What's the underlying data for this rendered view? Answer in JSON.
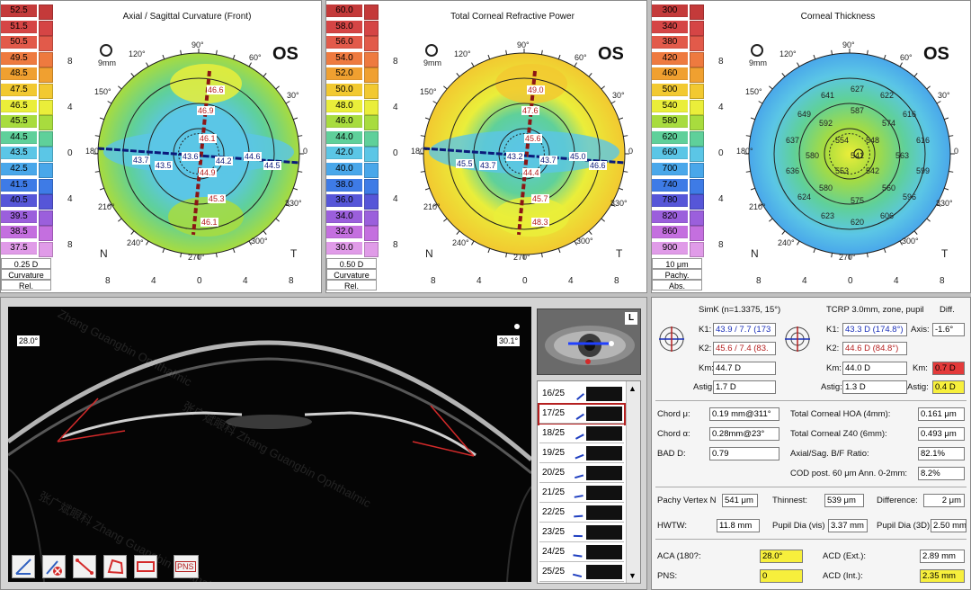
{
  "maps": [
    {
      "title": "Axial / Sagittal Curvature (Front)",
      "eye": "OS",
      "scale_values": [
        "52.5",
        "51.5",
        "50.5",
        "49.5",
        "48.5",
        "47.5",
        "46.5",
        "45.5",
        "44.5",
        "43.5",
        "42.5",
        "41.5",
        "40.5",
        "39.5",
        "38.5",
        "37.5"
      ],
      "scale_colors": [
        "#c43a3a",
        "#d54545",
        "#e25a4a",
        "#ee7a3f",
        "#f0a030",
        "#f2c930",
        "#eaee3a",
        "#a8dc3e",
        "#5fd09a",
        "#5bc6e6",
        "#49a7ea",
        "#3e7be6",
        "#5656d8",
        "#9b5fdc",
        "#c46fdf",
        "#e09be8"
      ],
      "step": "0.25 D",
      "scale_type": "Curvature",
      "mode": "Rel.",
      "values": [
        {
          "v": "46.6",
          "x": 229,
          "y": 94,
          "c": "red"
        },
        {
          "v": "46.9",
          "x": 218,
          "y": 117,
          "c": "red"
        },
        {
          "v": "46.1",
          "x": 220,
          "y": 148,
          "c": "red"
        },
        {
          "v": "43.7",
          "x": 146,
          "y": 172,
          "c": "blue"
        },
        {
          "v": "43.5",
          "x": 171,
          "y": 178,
          "c": "blue"
        },
        {
          "v": "43.6",
          "x": 201,
          "y": 168,
          "c": "blue"
        },
        {
          "v": "44.2",
          "x": 238,
          "y": 173,
          "c": "blue"
        },
        {
          "v": "44.6",
          "x": 270,
          "y": 168,
          "c": "blue"
        },
        {
          "v": "44.5",
          "x": 292,
          "y": 178,
          "c": "blue"
        },
        {
          "v": "44.9",
          "x": 220,
          "y": 186,
          "c": "red"
        },
        {
          "v": "45.3",
          "x": 230,
          "y": 215,
          "c": "red"
        },
        {
          "v": "46.1",
          "x": 222,
          "y": 241,
          "c": "red"
        }
      ]
    },
    {
      "title": "Total Corneal Refractive Power",
      "eye": "OS",
      "scale_values": [
        "60.0",
        "58.0",
        "56.0",
        "54.0",
        "52.0",
        "50.0",
        "48.0",
        "46.0",
        "44.0",
        "42.0",
        "40.0",
        "38.0",
        "36.0",
        "34.0",
        "32.0",
        "30.0"
      ],
      "scale_colors": [
        "#c43a3a",
        "#d54545",
        "#e25a4a",
        "#ee7a3f",
        "#f0a030",
        "#f2c930",
        "#eaee3a",
        "#a8dc3e",
        "#5fd09a",
        "#5bc6e6",
        "#49a7ea",
        "#3e7be6",
        "#5656d8",
        "#9b5fdc",
        "#c46fdf",
        "#e09be8"
      ],
      "step": "0.50 D",
      "scale_type": "Curvature",
      "mode": "Rel.",
      "values": [
        {
          "v": "49.0",
          "x": 585,
          "y": 94,
          "c": "red"
        },
        {
          "v": "47.6",
          "x": 579,
          "y": 117,
          "c": "red"
        },
        {
          "v": "45.6",
          "x": 582,
          "y": 148,
          "c": "red"
        },
        {
          "v": "45.5",
          "x": 506,
          "y": 176,
          "c": "blue"
        },
        {
          "v": "43.7",
          "x": 532,
          "y": 178,
          "c": "blue"
        },
        {
          "v": "43.2",
          "x": 562,
          "y": 168,
          "c": "blue"
        },
        {
          "v": "43.7",
          "x": 599,
          "y": 172,
          "c": "blue"
        },
        {
          "v": "45.0",
          "x": 632,
          "y": 168,
          "c": "blue"
        },
        {
          "v": "46.6",
          "x": 654,
          "y": 178,
          "c": "blue"
        },
        {
          "v": "44.4",
          "x": 580,
          "y": 186,
          "c": "red"
        },
        {
          "v": "45.7",
          "x": 590,
          "y": 215,
          "c": "red"
        },
        {
          "v": "48.3",
          "x": 590,
          "y": 241,
          "c": "red"
        }
      ]
    },
    {
      "title": "Corneal Thickness",
      "eye": "OS",
      "scale_values": [
        "300",
        "340",
        "380",
        "420",
        "460",
        "500",
        "540",
        "580",
        "620",
        "660",
        "700",
        "740",
        "780",
        "820",
        "860",
        "900"
      ],
      "scale_colors": [
        "#c43a3a",
        "#d54545",
        "#e25a4a",
        "#ee7a3f",
        "#f0a030",
        "#f2c930",
        "#eaee3a",
        "#a8dc3e",
        "#5fd09a",
        "#5bc6e6",
        "#49a7ea",
        "#3e7be6",
        "#5656d8",
        "#9b5fdc",
        "#c46fdf",
        "#e09be8"
      ],
      "step": "10 μm",
      "scale_type": "Pachy.",
      "mode": "Abs.",
      "values": [
        {
          "v": "641",
          "x": 911,
          "y": 100,
          "c": "dark"
        },
        {
          "v": "627",
          "x": 944,
          "y": 93,
          "c": "dark"
        },
        {
          "v": "622",
          "x": 977,
          "y": 100,
          "c": "dark"
        },
        {
          "v": "649",
          "x": 885,
          "y": 121,
          "c": "dark"
        },
        {
          "v": "592",
          "x": 909,
          "y": 131,
          "c": "dark"
        },
        {
          "v": "587",
          "x": 944,
          "y": 117,
          "c": "dark"
        },
        {
          "v": "574",
          "x": 979,
          "y": 131,
          "c": "dark"
        },
        {
          "v": "616",
          "x": 1002,
          "y": 121,
          "c": "dark"
        },
        {
          "v": "637",
          "x": 872,
          "y": 150,
          "c": "dark"
        },
        {
          "v": "554",
          "x": 927,
          "y": 150,
          "c": "dark"
        },
        {
          "v": "548",
          "x": 961,
          "y": 150,
          "c": "dark"
        },
        {
          "v": "616",
          "x": 1017,
          "y": 150,
          "c": "dark"
        },
        {
          "v": "580",
          "x": 894,
          "y": 167,
          "c": "dark"
        },
        {
          "v": "541",
          "x": 944,
          "y": 167,
          "c": "dark"
        },
        {
          "v": "563",
          "x": 994,
          "y": 167,
          "c": "dark"
        },
        {
          "v": "636",
          "x": 872,
          "y": 184,
          "c": "dark"
        },
        {
          "v": "553",
          "x": 927,
          "y": 184,
          "c": "dark"
        },
        {
          "v": "542",
          "x": 961,
          "y": 184,
          "c": "dark"
        },
        {
          "v": "599",
          "x": 1017,
          "y": 184,
          "c": "dark"
        },
        {
          "v": "580",
          "x": 909,
          "y": 203,
          "c": "dark"
        },
        {
          "v": "560",
          "x": 979,
          "y": 203,
          "c": "dark"
        },
        {
          "v": "624",
          "x": 885,
          "y": 213,
          "c": "dark"
        },
        {
          "v": "575",
          "x": 944,
          "y": 217,
          "c": "dark"
        },
        {
          "v": "596",
          "x": 1002,
          "y": 213,
          "c": "dark"
        },
        {
          "v": "623",
          "x": 911,
          "y": 234,
          "c": "dark"
        },
        {
          "v": "620",
          "x": 944,
          "y": 241,
          "c": "dark"
        },
        {
          "v": "606",
          "x": 977,
          "y": 234,
          "c": "dark"
        }
      ]
    }
  ],
  "map_axes": {
    "zoom": "9mm",
    "deg_90": "90°",
    "deg_60": "60°",
    "deg_30": "30°",
    "deg_0": "0",
    "deg_330": "330°",
    "deg_300": "300°",
    "deg_270": "270°",
    "deg_240": "240°",
    "deg_210": "210°",
    "deg_180": "180°",
    "deg_150": "150°",
    "deg_120": "120°",
    "y_ticks": [
      "8",
      "4",
      "0",
      "4",
      "8"
    ],
    "x_ticks": [
      "8",
      "4",
      "0",
      "4",
      "8"
    ],
    "nasal": "N",
    "temporal": "T"
  },
  "oct": {
    "angle_left": "28.0°",
    "angle_right": "30.1°",
    "eye_letter": "L",
    "watermark_cn": "张广斌眼科",
    "watermark_en": "Zhang Guangbin Ophthalmic",
    "tools": [
      "angle-tool",
      "erase-tool",
      "line-tool",
      "polygon-tool",
      "distance-tool",
      "pns-tool"
    ],
    "pns_label": "PNS"
  },
  "slices": {
    "items": [
      "16/25",
      "17/25",
      "18/25",
      "19/25",
      "20/25",
      "21/25",
      "22/25",
      "23/25",
      "24/25",
      "25/25"
    ],
    "selected": "17/25"
  },
  "results": {
    "simk_header": "SimK (n=1.3375, 15°)",
    "tcrp_header": "TCRP 3.0mm, zone, pupil",
    "diff_header": "Diff.",
    "k1_label": "K1:",
    "k2_label": "K2:",
    "km_label": "Km:",
    "astig_label": "Astig:",
    "axis_label": "Axis:",
    "simk_k1": "43.9 / 7.7 (173",
    "simk_k2": "45.6 / 7.4 (83.",
    "simk_km": "44.7 D",
    "simk_astig": "1.7 D",
    "tcrp_k1": "43.3 D (174.8°)",
    "tcrp_k2": "44.6 D (84.8°)",
    "tcrp_km": "44.0 D",
    "tcrp_astig": "1.3 D",
    "diff_axis": "-1.6°",
    "diff_km": "0.7 D",
    "diff_astig": "0.4 D",
    "chord_mu_label": "Chord μ:",
    "chord_mu": "0.19 mm@311°",
    "chord_alpha_label": "Chord α:",
    "chord_alpha": "0.28mm@23°",
    "bad_d_label": "BAD D:",
    "bad_d": "0.79",
    "hoa_label": "Total Corneal HOA (4mm):",
    "hoa": "0.161 μm",
    "z40_label": "Total Corneal Z40 (6mm):",
    "z40": "0.493 μm",
    "bf_label": "Axial/Sag. B/F Ratio:",
    "bf": "82.1%",
    "cod_label": "COD post. 60 μm Ann. 0-2mm:",
    "cod": "8.2%",
    "pachy_vertex_label": "Pachy Vertex N",
    "pachy_vertex": "541 μm",
    "thinnest_label": "Thinnest:",
    "thinnest": "539 μm",
    "difference_label": "Difference:",
    "difference": "2 μm",
    "hwtw_label": "HWTW:",
    "hwtw": "11.8 mm",
    "pupil_vis_label": "Pupil Dia (vis)",
    "pupil_vis": "3.37 mm",
    "pupil_3d_label": "Pupil Dia (3D)",
    "pupil_3d": "2.50 mm",
    "aca_label": "ACA (180?:",
    "aca": "28.0°",
    "pns_label": "PNS:",
    "pns": "0",
    "acd_ext_label": "ACD (Ext.):",
    "acd_ext": "2.89 mm",
    "acd_int_label": "ACD (Int.):",
    "acd_int": "2.35 mm"
  },
  "colors": {
    "highlight_yellow": "#f7ef3c",
    "highlight_red": "#e43a3a",
    "k1_blue": "#1a2fb8",
    "k2_red": "#b52020"
  }
}
